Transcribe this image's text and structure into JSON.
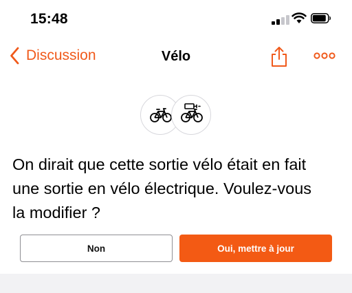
{
  "status_bar": {
    "time": "15:48",
    "signal_bars": 2
  },
  "nav": {
    "back_label": "Discussion",
    "title": "Vélo",
    "share_icon": "share-icon",
    "more_icon": "more-icon"
  },
  "icons": {
    "bike": "bicycle-icon",
    "ebike": "electric-bicycle-icon"
  },
  "prompt": {
    "line1": "On dirait que cette sortie vélo était en fait",
    "line2": "une sortie en vélo électrique. Voulez-vous",
    "line3": "la modifier ?"
  },
  "buttons": {
    "no_label": "Non",
    "yes_label": "Oui, mettre à jour"
  },
  "colors": {
    "accent": "#f35a14",
    "text": "#000000",
    "background": "#f2f2f4"
  }
}
